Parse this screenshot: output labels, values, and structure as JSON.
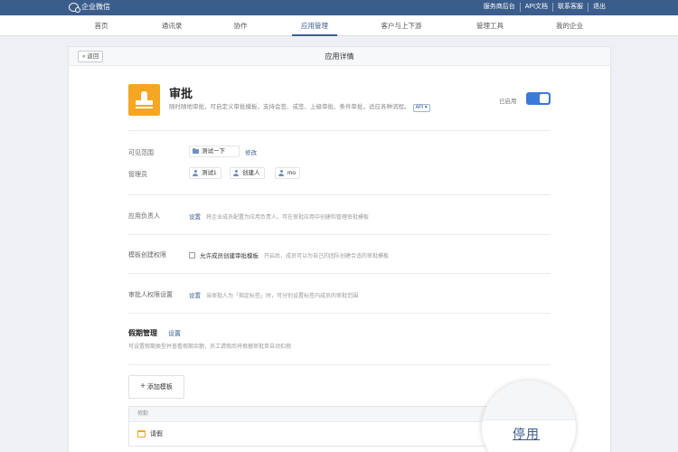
{
  "topbar": {
    "logo_text": "企业微信",
    "links": [
      "服务商后台",
      "API文档",
      "联系客服",
      "退出"
    ]
  },
  "nav": {
    "items": [
      "首页",
      "通讯录",
      "协作",
      "应用管理",
      "客户与上下游",
      "管理工具",
      "我的企业"
    ],
    "active_index": 3
  },
  "page": {
    "back_label": "« 返回",
    "title": "应用详情"
  },
  "app": {
    "icon": "stamp-icon",
    "name": "审批",
    "description": "随时随地审批，可自定义审批模板，支持会签、或签、上级审批、条件审批，适应各种流程。",
    "api_tag": "API ▾",
    "status_label": "已启用",
    "enabled": true
  },
  "visibility": {
    "label": "可见范围",
    "value": "测试一下",
    "edit": "修改"
  },
  "admins": {
    "label": "管理员",
    "items": [
      "测试1",
      "创建人",
      "mo"
    ]
  },
  "owner": {
    "label": "应用负责人",
    "action": "设置",
    "hint": "将企业成员配置为应用负责人，可在审批应用中创建和管理审批模板"
  },
  "template_perm": {
    "label": "模板创建权限",
    "checkbox_label": "允许成员创建审批模板",
    "hint": "开启后，成员可以为自己的团队创建合适的审批模板"
  },
  "approver_perm": {
    "label": "审批人权限设置",
    "action": "设置",
    "hint": "当审批人为「指定标签」时，可分别设置标签内成员的审批范围"
  },
  "leave": {
    "title": "假期管理",
    "action": "设置",
    "description": "可设置假期类型并查看假期余额，员工请假后将根据审批单自动扣假"
  },
  "templates": {
    "add_label": "添加模板",
    "group_label": "假勤",
    "rows": [
      {
        "icon": "calendar-icon",
        "name": "请假"
      }
    ],
    "disable_label": "停用"
  }
}
